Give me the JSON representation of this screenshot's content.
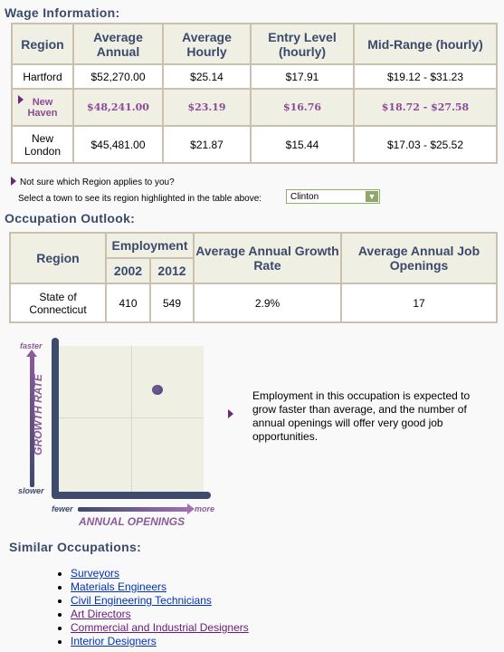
{
  "wage": {
    "title": "Wage Information:",
    "headers": [
      "Region",
      "Average Annual",
      "Average Hourly",
      "Entry Level (hourly)",
      "Mid-Range (hourly)"
    ],
    "rows": [
      {
        "region": "Hartford",
        "annual": "$52,270.00",
        "hourly": "$25.14",
        "entry": "$17.91",
        "mid": "$19.12 - $31.23"
      },
      {
        "region": "New Haven",
        "annual": "$48,241.00",
        "hourly": "$23.19",
        "entry": "$16.76",
        "mid": "$18.72 - $27.58",
        "highlighted": true
      },
      {
        "region": "New London",
        "annual": "$45,481.00",
        "hourly": "$21.87",
        "entry": "$15.44",
        "mid": "$17.03 - $25.52"
      }
    ]
  },
  "region_help": {
    "question": "Not sure which Region applies to you?",
    "prompt": "Select a town to see its region highlighted in the table above:",
    "selected_town": "Clinton"
  },
  "outlook": {
    "title": "Occupation Outlook:",
    "headers": {
      "region": "Region",
      "employment": "Employment",
      "y1": "2002",
      "y2": "2012",
      "growth": "Average Annual Growth Rate",
      "openings": "Average Annual Job Openings"
    },
    "row": {
      "region": "State of Connecticut",
      "y1": "410",
      "y2": "549",
      "growth": "2.9%",
      "openings": "17"
    }
  },
  "chart": {
    "y_label": "GROWTH RATE",
    "y_top": "faster",
    "y_bottom": "slower",
    "x_label": "ANNUAL OPENINGS",
    "x_left": "fewer",
    "x_right": "more",
    "point_quadrant": "faster growth / more openings",
    "description": "Employment in this occupation is expected to grow faster than average, and the number of annual openings will offer very good job opportunities."
  },
  "similar": {
    "title": "Similar Occupations:",
    "items": [
      {
        "label": "Surveyors",
        "visited": false
      },
      {
        "label": "Materials Engineers",
        "visited": false
      },
      {
        "label": "Civil Engineering Technicians",
        "visited": false
      },
      {
        "label": "Art Directors",
        "visited": true
      },
      {
        "label": "Commercial and Industrial Designers",
        "visited": true
      },
      {
        "label": "Interior Designers",
        "visited": false
      }
    ]
  },
  "colors": {
    "heading": "#3b4a6b",
    "highlight": "#8a4c97",
    "header_bg": "#f0efe3"
  }
}
